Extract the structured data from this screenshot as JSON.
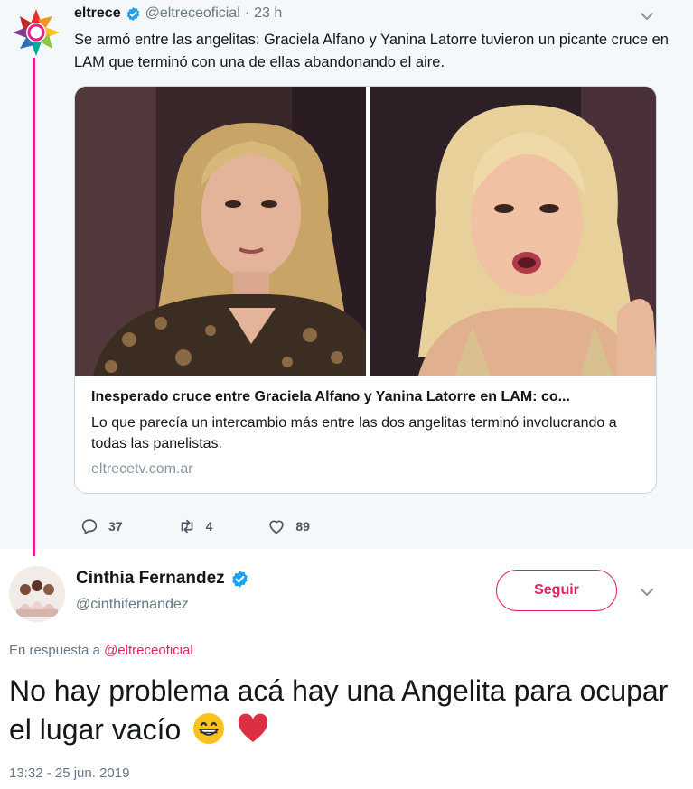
{
  "parent_tweet": {
    "author_name": "eltrece",
    "author_handle": "@eltreceoficial",
    "separator": "·",
    "time": "23 h",
    "text": "Se armó entre las angelitas: Graciela Alfano y Yanina Latorre tuvieron un picante cruce en LAM que terminó con una de ellas abandonando el aire.",
    "card": {
      "title": "Inesperado cruce entre Graciela Alfano y Yanina Latorre en LAM: co...",
      "description": "Lo que parecía un intercambio más entre las dos angelitas terminó involucrando a todas las panelistas.",
      "domain": "eltrecetv.com.ar"
    },
    "actions": {
      "reply_count": "37",
      "retweet_count": "4",
      "like_count": "89"
    }
  },
  "reply_tweet": {
    "author_name": "Cinthia Fernandez",
    "author_handle": "@cinthifernandez",
    "follow_label": "Seguir",
    "in_reply_prefix": "En respuesta a",
    "in_reply_mention": "@eltreceoficial",
    "text": "No hay problema acá hay una Angelita para ocupar el lugar vacío",
    "timestamp": "13:32 - 25 jun. 2019"
  },
  "colors": {
    "accent": "#e0245e",
    "thread_line": "#e61f8b",
    "verified": "#1da1f2",
    "muted": "#657786",
    "parent_bg": "#f5f8fa"
  },
  "icons": [
    "eltrece-logo",
    "verified-badge-icon",
    "chevron-down-icon",
    "reply-icon",
    "retweet-icon",
    "like-icon",
    "grinning-face-emoji",
    "red-heart-emoji"
  ]
}
